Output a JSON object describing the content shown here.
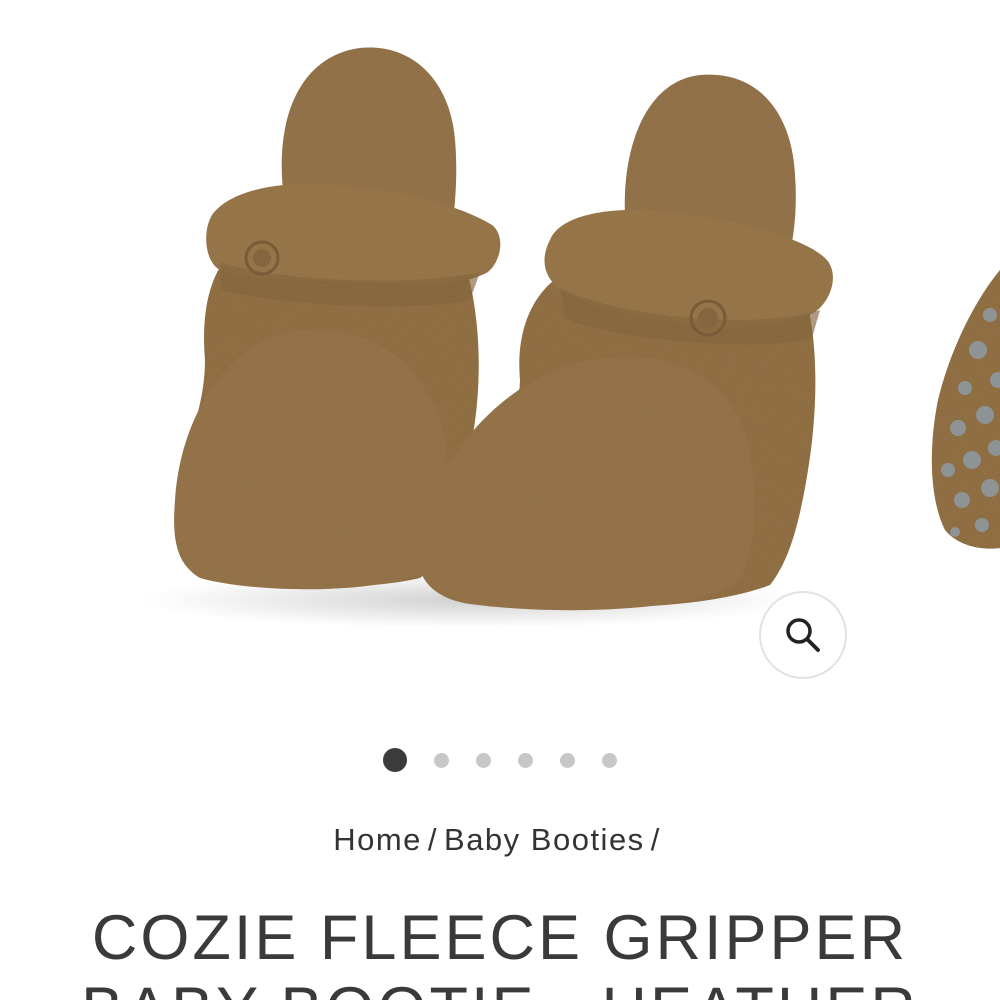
{
  "gallery": {
    "image_alt": "Cozie fleece gripper baby booties in heather brown",
    "zoom_icon": "search-icon",
    "dot_count": 6,
    "active_dot": 1
  },
  "breadcrumb": {
    "home": "Home",
    "separator": "/",
    "category": "Baby Booties"
  },
  "product": {
    "title": "COZIE FLEECE GRIPPER BABY BOOTIE - HEATHER"
  },
  "colors": {
    "fleece_brown": "#8a6538",
    "gripper_dots": "#8e989e",
    "active_dot": "#3b3b3b",
    "inactive_dot": "#c7c7c7",
    "text": "#333333"
  }
}
